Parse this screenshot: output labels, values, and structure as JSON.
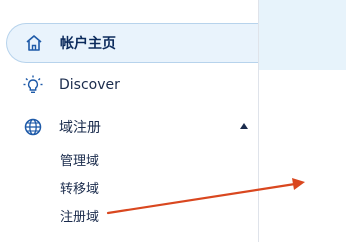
{
  "sidebar": {
    "items": [
      {
        "label": "帐户主页",
        "icon": "home-icon",
        "active": true
      },
      {
        "label": "Discover",
        "icon": "lightbulb-icon",
        "active": false
      },
      {
        "label": "域注册",
        "icon": "globe-icon",
        "active": false,
        "expanded": true,
        "children": [
          {
            "label": "管理域"
          },
          {
            "label": "转移域"
          },
          {
            "label": "注册域"
          }
        ]
      }
    ]
  },
  "colors": {
    "accent": "#1e5aa8",
    "active_bg": "#e9f3fc",
    "annotation_arrow": "#d9471f",
    "text": "#1a2b4c"
  }
}
